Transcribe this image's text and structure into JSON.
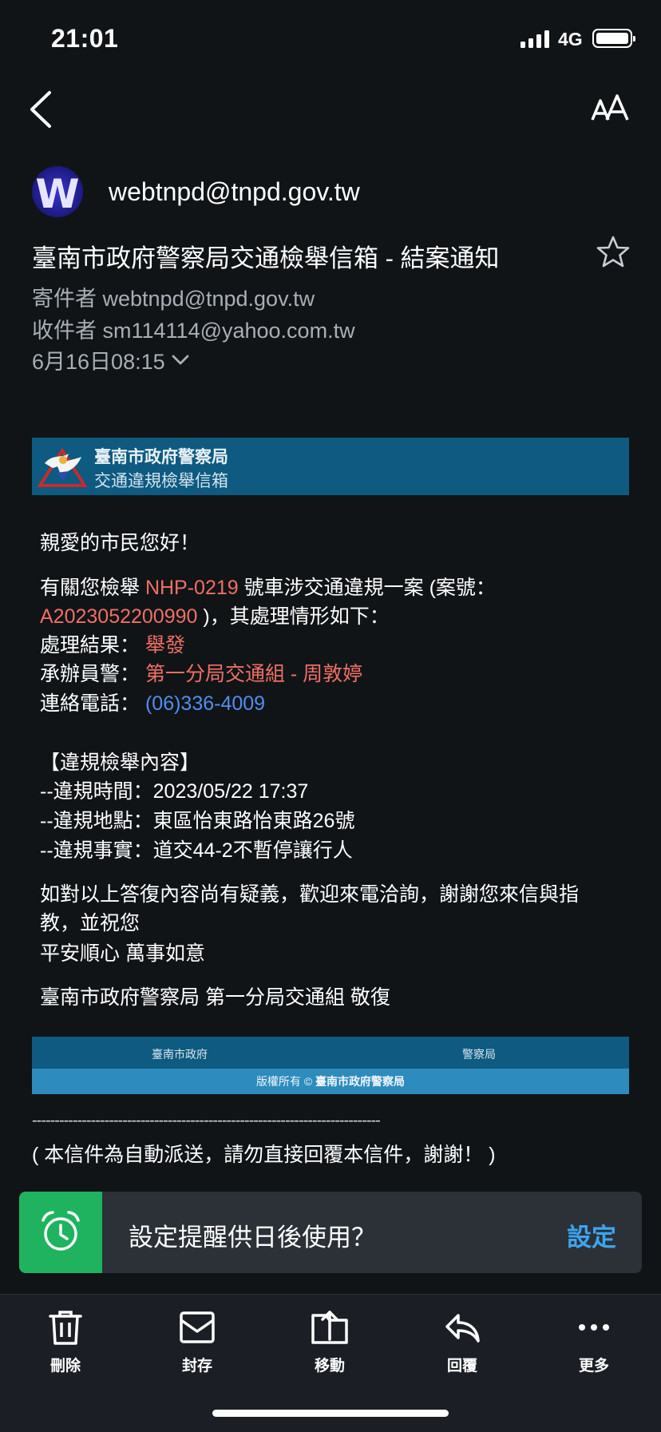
{
  "status_bar": {
    "time": "21:01",
    "network": "4G"
  },
  "header": {
    "avatar_letter": "W",
    "sender_name": "webtnpd@tnpd.gov.tw",
    "subject": "臺南市政府警察局交通檢舉信箱 - 結案通知",
    "from": "寄件者 webtnpd@tnpd.gov.tw",
    "to": "收件者 sm114114@yahoo.com.tw",
    "date": "6月16日08:15"
  },
  "email": {
    "banner_title": "臺南市政府警察局",
    "banner_subtitle": "交通違規檢舉信箱",
    "greeting": "親愛的市民您好！",
    "para1_prefix": "有關您檢舉 ",
    "plate": "NHP-0219",
    "para1_mid": " 號車涉交通違規一案 (案號：",
    "case_no": "A2023052200990",
    "para1_suffix": " )，其處理情形如下：",
    "result_label": "處理結果：",
    "result_value": "舉發",
    "officer_label": "承辦員警：",
    "officer_value": "第一分局交通組 - 周敦婷",
    "phone_label": "連絡電話：",
    "phone_value": "(06)336-4009",
    "section_title": "【違規檢舉內容】",
    "violation_time": "--違規時間：2023/05/22 17:37",
    "violation_place": "--違規地點：東區怡東路怡東路26號",
    "violation_fact": "--違規事實：道交44-2不暫停讓行人",
    "closing1": "如對以上答復內容尚有疑義，歡迎來電洽詢，謝謝您來信與指",
    "closing2": "教，並祝您",
    "closing3": "平安順心 萬事如意",
    "signature": "臺南市政府警察局 第一分局交通組 敬復",
    "footer_left": "臺南市政府",
    "footer_right": "警察局",
    "copyright_prefix": "版權所有 © ",
    "copyright_org": "臺南市政府警察局",
    "dashes": "-----------------------------------------------------------------------------",
    "auto_note": "( 本信件為自動派送，請勿直接回覆本信件，謝謝！ )"
  },
  "reminder": {
    "text": "設定提醒供日後使用？",
    "action": "設定"
  },
  "toolbar": {
    "delete": "刪除",
    "archive": "封存",
    "move": "移動",
    "reply": "回覆",
    "more": "更多"
  },
  "colors": {
    "background": "#101417",
    "highlight_red": "#f06f64",
    "link_blue": "#4f8fee",
    "banner_blue": "#0e5a80",
    "reminder_green": "#1fb35f",
    "action_blue": "#3da4ef"
  }
}
